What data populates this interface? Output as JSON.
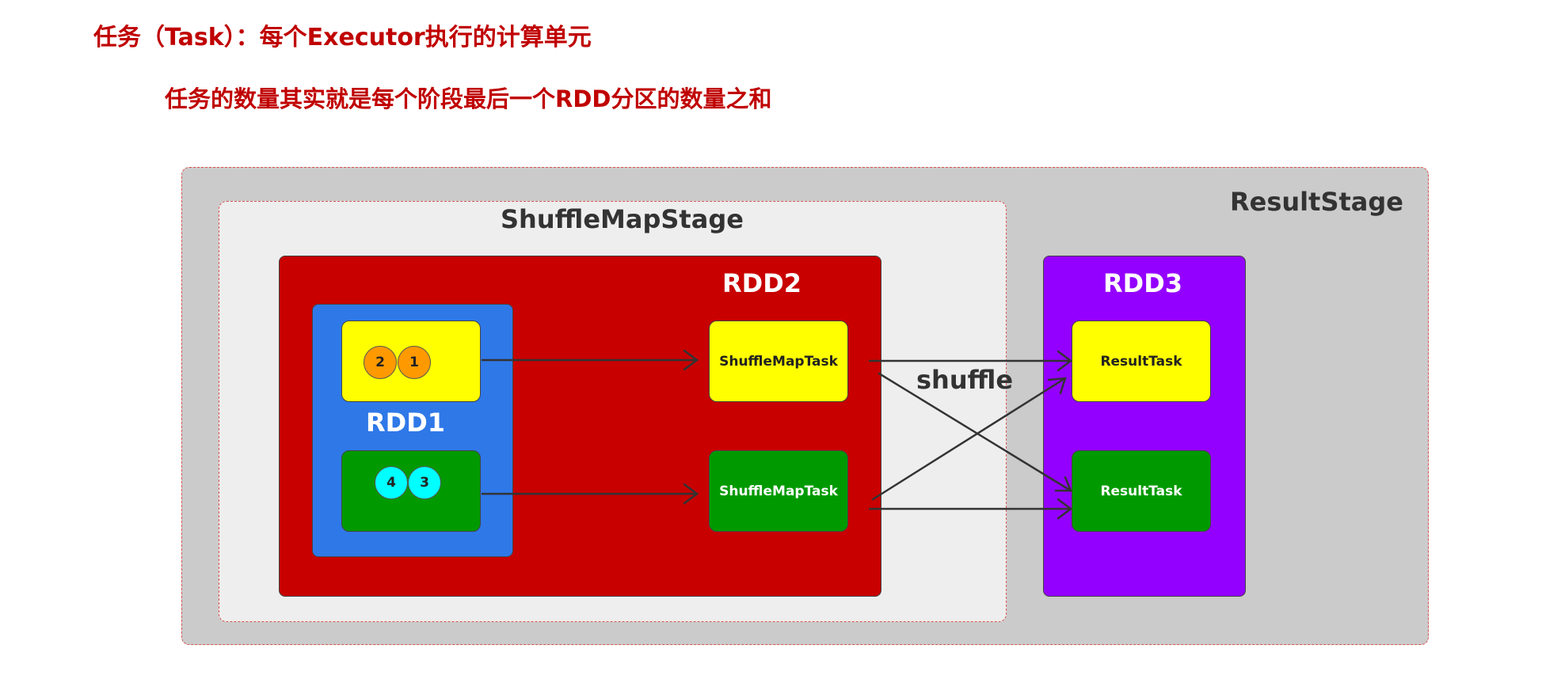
{
  "title": "任务（Task）：每个Executor执行的计算单元",
  "subtitle": "任务的数量其实就是每个阶段最后一个RDD分区的数量之和",
  "stages": {
    "result": "ResultStage",
    "shuffle_map": "ShuffleMapStage"
  },
  "rdds": {
    "rdd1": "RDD1",
    "rdd2": "RDD2",
    "rdd3": "RDD3"
  },
  "partitions": {
    "rdd1_top": [
      "2",
      "1"
    ],
    "rdd1_bottom": [
      "4",
      "3"
    ]
  },
  "tasks": {
    "shuffle_map_top": "ShuffleMapTask",
    "shuffle_map_bottom": "ShuffleMapTask",
    "result_top": "ResultTask",
    "result_bottom": "ResultTask"
  },
  "shuffle_label": "shuffle",
  "colors": {
    "heading": "#c00000",
    "rdd1": "#2f78e8",
    "rdd2": "#c80000",
    "rdd3": "#9400ff",
    "yellow": "#ffff00",
    "green": "#009a00",
    "orange": "#ff9900",
    "cyan": "#00ffff"
  }
}
